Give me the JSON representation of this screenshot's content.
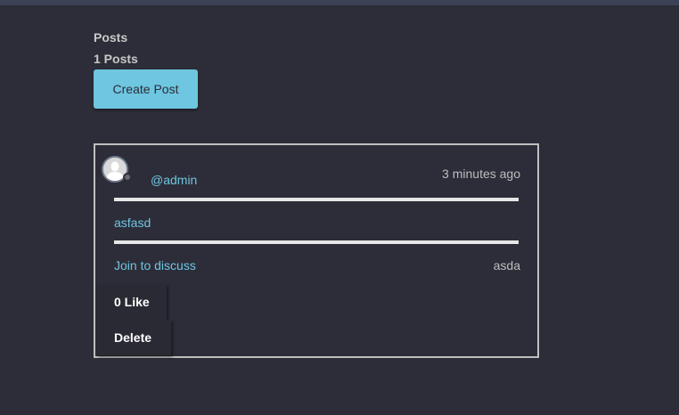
{
  "page": {
    "section_title": "Posts",
    "post_count": "1 Posts",
    "create_button_label": "Create Post"
  },
  "post": {
    "username": "@admin",
    "timestamp": "3 minutes ago",
    "body": "asfasd",
    "discuss_link": "Join to discuss",
    "tag": "asda",
    "like_label": "0 Like",
    "delete_label": "Delete"
  },
  "icons": {
    "avatar": "user-avatar-icon",
    "status": "status-dot-icon"
  },
  "colors": {
    "background": "#2d2d39",
    "accent": "#6ec6e0",
    "text": "#c8c8c8",
    "card_border": "#bfbfbf"
  }
}
